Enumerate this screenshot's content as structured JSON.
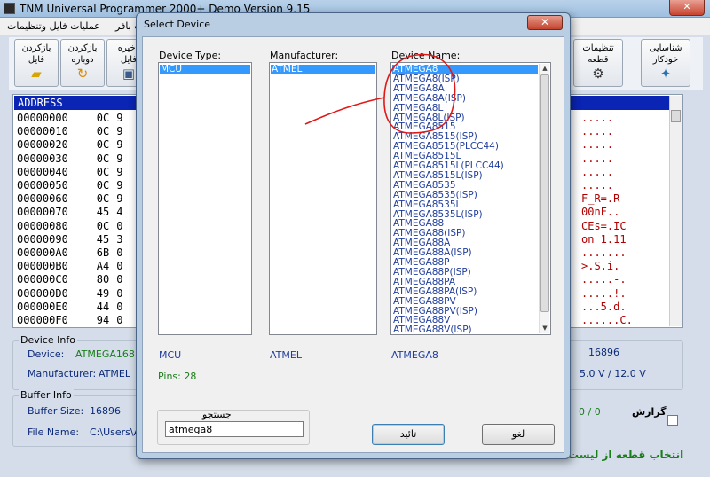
{
  "main_window": {
    "title": "TNM  Universal Programmer 2000+ Demo   Version 9.15",
    "close_glyph": "✕",
    "menu": [
      "عملیات فایل وتنظیمات",
      "عملیات بافر"
    ],
    "toolbar": {
      "reload_file": "بازکردن\nفایل",
      "reopen": "بازکردن\nدوباره",
      "save_file": "ذخیره\nفایل",
      "chip_settings": "تنظیمات\nقطعه",
      "auto_detect": "شناسایی\nخودکار"
    },
    "hex": {
      "header": "ADDRESS",
      "rows": [
        {
          "addr": "00000000",
          "b1": "0C",
          "b2": "9",
          "ascii": "....."
        },
        {
          "addr": "00000010",
          "b1": "0C",
          "b2": "9",
          "ascii": "....."
        },
        {
          "addr": "00000020",
          "b1": "0C",
          "b2": "9",
          "ascii": "....."
        },
        {
          "addr": "00000030",
          "b1": "0C",
          "b2": "9",
          "ascii": "....."
        },
        {
          "addr": "00000040",
          "b1": "0C",
          "b2": "9",
          "ascii": "....."
        },
        {
          "addr": "00000050",
          "b1": "0C",
          "b2": "9",
          "ascii": "....."
        },
        {
          "addr": "00000060",
          "b1": "0C",
          "b2": "9",
          "ascii": "F_R=.R"
        },
        {
          "addr": "00000070",
          "b1": "45",
          "b2": "4",
          "ascii": "00nF.."
        },
        {
          "addr": "00000080",
          "b1": "0C",
          "b2": "0",
          "ascii": "CEs=.IC"
        },
        {
          "addr": "00000090",
          "b1": "45",
          "b2": "3",
          "ascii": "on 1.11"
        },
        {
          "addr": "000000A0",
          "b1": "6B",
          "b2": "0",
          "ascii": "......."
        },
        {
          "addr": "000000B0",
          "b1": "A4",
          "b2": "0",
          "ascii": ">.S.i."
        },
        {
          "addr": "000000C0",
          "b1": "80",
          "b2": "0",
          "ascii": ".....-."
        },
        {
          "addr": "000000D0",
          "b1": "49",
          "b2": "0",
          "ascii": ".....!."
        },
        {
          "addr": "000000E0",
          "b1": "44",
          "b2": "0",
          "ascii": "...5.d."
        },
        {
          "addr": "000000F0",
          "b1": "94",
          "b2": "0",
          "ascii": "......C."
        }
      ]
    },
    "device_info": {
      "title": "Device Info",
      "device_label": "Device:",
      "device_value": "ATMEGA168",
      "manufacturer_label": "Manufacturer:",
      "manufacturer_value": "ATMEL",
      "size_value": "16896",
      "voltage": "5.0 V / 12.0 V"
    },
    "buffer_info": {
      "title": "Buffer Info",
      "size_label": "Buffer Size:",
      "size_value": "16896",
      "file_label": "File Name:",
      "file_value": "C:\\Users\\Al",
      "progress": "0 / 0"
    },
    "report_label": "گزارش",
    "bottom_hint": "انتخاب قطعه از لیست"
  },
  "dialog": {
    "title": "Select Device",
    "close_glyph": "✕",
    "device_type": {
      "header": "Device Type:",
      "items": [
        "MCU"
      ],
      "selected": "MCU"
    },
    "manufacturer": {
      "header": "Manufacturer:",
      "items": [
        "ATMEL"
      ],
      "selected": "ATMEL"
    },
    "device_name": {
      "header": "Device Name:",
      "items": [
        "ATMEGA8",
        "ATMEGA8(ISP)",
        "ATMEGA8A",
        "ATMEGA8A(ISP)",
        "ATMEGA8L",
        "ATMEGA8L(ISP)",
        "ATMEGA8515",
        "ATMEGA8515(ISP)",
        "ATMEGA8515(PLCC44)",
        "ATMEGA8515L",
        "ATMEGA8515L(PLCC44)",
        "ATMEGA8515L(ISP)",
        "ATMEGA8535",
        "ATMEGA8535(ISP)",
        "ATMEGA8535L",
        "ATMEGA8535L(ISP)",
        "ATMEGA88",
        "ATMEGA88(ISP)",
        "ATMEGA88A",
        "ATMEGA88A(ISP)",
        "ATMEGA88P",
        "ATMEGA88P(ISP)",
        "ATMEGA88PA",
        "ATMEGA88PA(ISP)",
        "ATMEGA88PV",
        "ATMEGA88PV(ISP)",
        "ATMEGA88V",
        "ATMEGA88V(ISP)"
      ],
      "selected": "ATMEGA8"
    },
    "summary": {
      "type": "MCU",
      "manufacturer": "ATMEL",
      "device": "ATMEGA8"
    },
    "pins": "Pins: 28",
    "search": {
      "label": "جستجو",
      "value": "atmega8"
    },
    "ok_label": "تائید",
    "cancel_label": "لغو"
  }
}
